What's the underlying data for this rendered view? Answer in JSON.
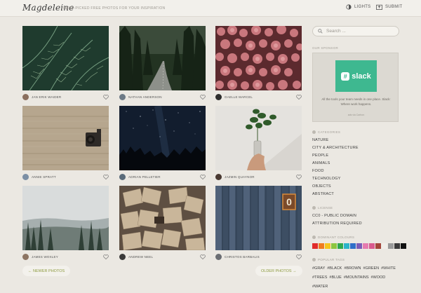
{
  "header": {
    "logo": "Magdeleine",
    "tagline": "HAND-PICKED FREE PHOTOS FOR YOUR INSPIRATION",
    "lights_label": "LIGHTS",
    "submit_label": "SUBMIT"
  },
  "photos": [
    {
      "author": "JAN ERIK WAIDER",
      "subject": "fern leaves"
    },
    {
      "author": "NATHAN ANDERSON",
      "subject": "forest road"
    },
    {
      "author": "GAELLE MARCEL",
      "subject": "pink flowers"
    },
    {
      "author": "ANNIE SPRATT",
      "subject": "camera on wooden table"
    },
    {
      "author": "ADRIAN PELLETIER",
      "subject": "starry night over trees"
    },
    {
      "author": "JAZMIN QUAYNOR",
      "subject": "plant in glass bottle"
    },
    {
      "author": "JAMES WOXLEY",
      "subject": "misty forest"
    },
    {
      "author": "ANDREW NEEL",
      "subject": "scattered papers"
    },
    {
      "author": "CHRISTOS BARBALIS",
      "subject": "wooden wall with number 0"
    }
  ],
  "pagination": {
    "newer_label": "← NEWER PHOTOS",
    "older_label": "OLDER PHOTOS →"
  },
  "search": {
    "placeholder": "Search ..."
  },
  "sponsor": {
    "heading": "OUR SPONSOR",
    "logo_text": "slack",
    "text": "All the tools your team needs in one place. Slack: Where work happens.",
    "via": "ads via Carbon"
  },
  "categories": {
    "heading": "CATEGORIES",
    "items": [
      "NATURE",
      "CITY & ARCHITECTURE",
      "PEOPLE",
      "ANIMALS",
      "FOOD",
      "TECHNOLOGY",
      "OBJECTS",
      "ABSTRACT"
    ]
  },
  "license": {
    "heading": "LICENSE",
    "items": [
      "CC0 - PUBLIC DOMAIN",
      "ATTRIBUTION REQUIRED"
    ]
  },
  "colours": {
    "heading": "DOMINANT COLOURS",
    "swatches": [
      "#e02a2a",
      "#f07b1e",
      "#f5c51d",
      "#8cc63f",
      "#2fa84f",
      "#2bb4c9",
      "#2f6fc9",
      "#7c5bb8",
      "#e57bb0",
      "#d95a8e",
      "#a3453a",
      "#f0eee9",
      "#9a9a9a",
      "#3a3a3a",
      "#111111"
    ]
  },
  "tags": {
    "heading": "POPULAR TAGS",
    "line1": [
      "#GRAY",
      "#BLACK",
      "#BROWN",
      "#GREEN",
      "#WHITE"
    ],
    "line2": [
      "#TREES",
      "#BLUE",
      "#MOUNTAINS",
      "#WOOD"
    ],
    "line3": [
      "#WATER"
    ]
  }
}
